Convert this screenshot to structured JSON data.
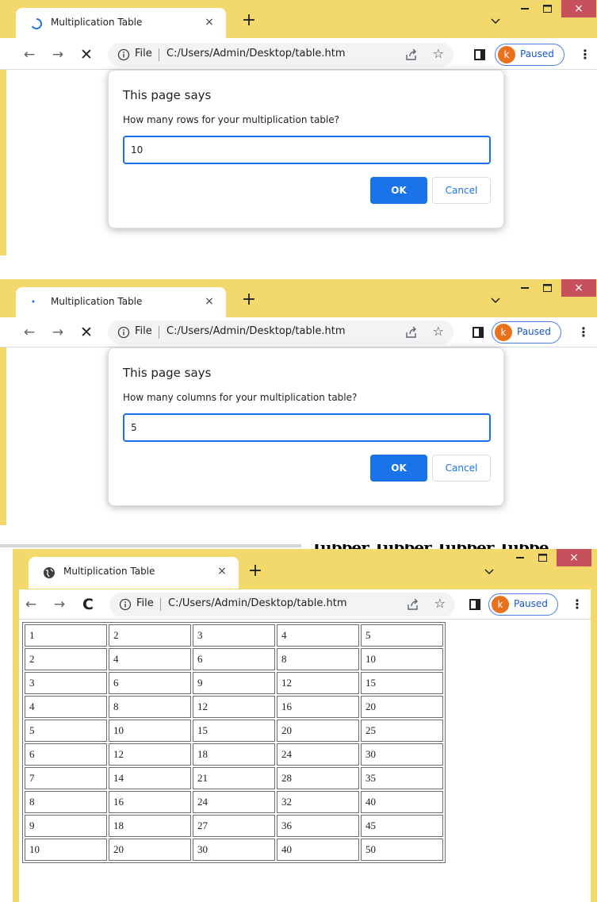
{
  "screens": [
    {
      "tab_title": "Multiplication Table",
      "tab_close": "×",
      "new_tab": "+",
      "window_close": "×",
      "nav": {
        "back": "←",
        "forward": "→",
        "reload": "✕"
      },
      "address": {
        "scheme": "File",
        "url": "C:/Users/Admin/Desktop/table.htm",
        "star": "☆"
      },
      "profile": {
        "initial": "k",
        "status": "Paused"
      },
      "menu": "⋮",
      "dialog": {
        "title": "This page says",
        "message": "How many rows for your multiplication table?",
        "value": "10",
        "ok": "OK",
        "cancel": "Cancel"
      }
    },
    {
      "tab_title": "Multiplication Table",
      "tab_close": "×",
      "new_tab": "+",
      "window_close": "×",
      "nav": {
        "back": "←",
        "forward": "→",
        "reload": "✕"
      },
      "address": {
        "scheme": "File",
        "url": "C:/Users/Admin/Desktop/table.htm",
        "star": "☆"
      },
      "profile": {
        "initial": "k",
        "status": "Paused"
      },
      "menu": "⋮",
      "dialog": {
        "title": "This page says",
        "message": "How many columns for your multiplication table?",
        "value": "5",
        "ok": "OK",
        "cancel": "Cancel"
      }
    },
    {
      "tab_title": "Multiplication Table",
      "tab_close": "×",
      "new_tab": "+",
      "window_close": "×",
      "nav": {
        "back": "←",
        "forward": "→",
        "reload": "C"
      },
      "address": {
        "scheme": "File",
        "url": "C:/Users/Admin/Desktop/table.htm",
        "star": "☆"
      },
      "profile": {
        "initial": "k",
        "status": "Paused"
      },
      "menu": "⋮",
      "background_text": "Tubber Tubber Tubber Tubbe",
      "table": [
        [
          "1",
          "2",
          "3",
          "4",
          "5"
        ],
        [
          "2",
          "4",
          "6",
          "8",
          "10"
        ],
        [
          "3",
          "6",
          "9",
          "12",
          "15"
        ],
        [
          "4",
          "8",
          "12",
          "16",
          "20"
        ],
        [
          "5",
          "10",
          "15",
          "20",
          "25"
        ],
        [
          "6",
          "12",
          "18",
          "24",
          "30"
        ],
        [
          "7",
          "14",
          "21",
          "28",
          "35"
        ],
        [
          "8",
          "16",
          "24",
          "32",
          "40"
        ],
        [
          "9",
          "18",
          "27",
          "36",
          "45"
        ],
        [
          "10",
          "20",
          "30",
          "40",
          "50"
        ]
      ]
    }
  ]
}
